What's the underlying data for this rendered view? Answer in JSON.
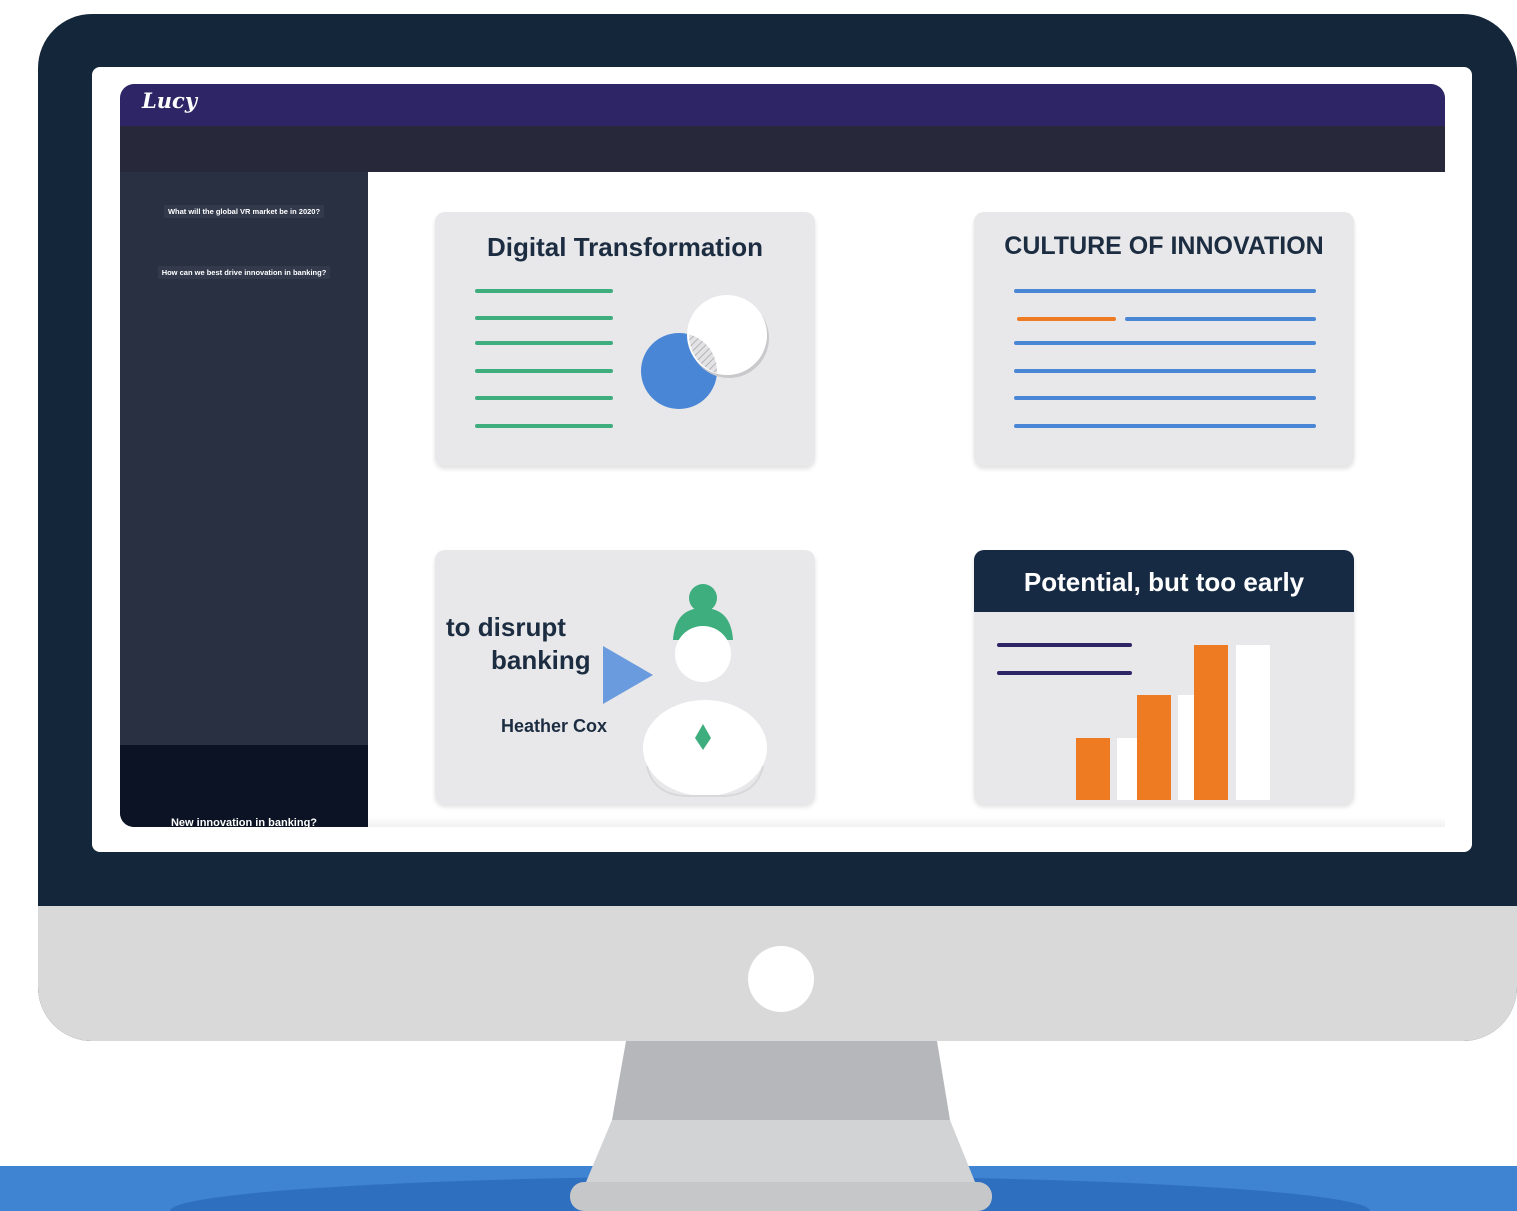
{
  "app": {
    "logo_text": "Lucy"
  },
  "sidebar": {
    "items": [
      {
        "label": "What will the global VR market be in 2020?"
      },
      {
        "label": "How can we best drive innovation in banking?"
      }
    ],
    "bottom_item": {
      "label": "New innovation in banking?"
    }
  },
  "cards": [
    {
      "title": "Digital Transformation"
    },
    {
      "title": "CULTURE OF INNOVATION"
    },
    {
      "line1": "to disrupt",
      "line2": "banking",
      "presenter": "Heather Cox"
    },
    {
      "title": "Potential, but too early"
    }
  ],
  "colors": {
    "monitor_frame": "#14263a",
    "header_purple": "#2d2565",
    "sidebar": "#283042",
    "green_lines": "#3fae7e",
    "blue_lines": "#4a86d6",
    "orange": "#ee7a22",
    "floor_blue": "#3f83d3"
  },
  "icons": [
    "venn-icon",
    "play-icon",
    "presenter-icon",
    "bar-chart-icon",
    "power-button-icon"
  ]
}
